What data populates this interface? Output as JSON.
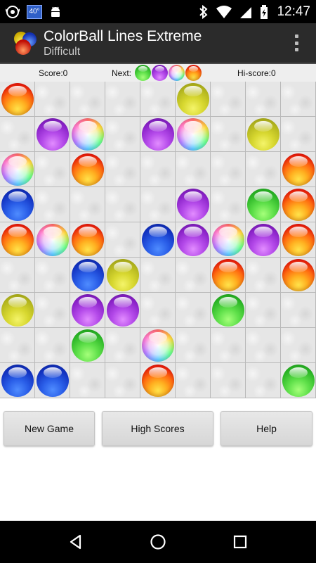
{
  "status_bar": {
    "temperature": "40°",
    "time": "12:47"
  },
  "app": {
    "title": "ColorBall Lines Extreme",
    "subtitle": "Difficult"
  },
  "score_row": {
    "score": "Score:0",
    "next_label": "Next:",
    "next_balls": [
      "green",
      "purple",
      "rainbow",
      "red"
    ],
    "hiscore": "Hi-score:0"
  },
  "board": {
    "rows": 9,
    "cols": 9,
    "cells": [
      [
        "red",
        "",
        "",
        "",
        "",
        "yellow",
        "",
        "",
        ""
      ],
      [
        "",
        "purple",
        "rainbow",
        "",
        "purple",
        "rainbow",
        "",
        "yellow",
        ""
      ],
      [
        "rainbow",
        "",
        "red",
        "",
        "",
        "",
        "",
        "",
        "red"
      ],
      [
        "blue",
        "",
        "",
        "",
        "",
        "purple",
        "",
        "green",
        "red"
      ],
      [
        "red",
        "rainbow",
        "red",
        "",
        "blue",
        "purple",
        "rainbow",
        "purple",
        "red"
      ],
      [
        "",
        "",
        "blue",
        "yellow",
        "",
        "",
        "red",
        "",
        "red"
      ],
      [
        "yellow",
        "",
        "purple",
        "purple",
        "",
        "",
        "green",
        "",
        ""
      ],
      [
        "",
        "",
        "green",
        "",
        "rainbow",
        "",
        "",
        "",
        ""
      ],
      [
        "blue",
        "blue",
        "",
        "",
        "red",
        "",
        "",
        "",
        "green"
      ]
    ]
  },
  "buttons": {
    "new_game": "New Game",
    "high_scores": "High Scores",
    "help": "Help"
  },
  "colors": {
    "action_bar": "#2b2b2b",
    "status_bar": "#000000",
    "board_bg": "#e6e6e6"
  },
  "icons": {
    "status_left": [
      "eye-icon",
      "temperature-badge",
      "android-icon"
    ],
    "status_right": [
      "bluetooth-icon",
      "wifi-icon",
      "signal-icon",
      "battery-icon"
    ],
    "nav": [
      "back-icon",
      "home-icon",
      "recents-icon"
    ]
  }
}
